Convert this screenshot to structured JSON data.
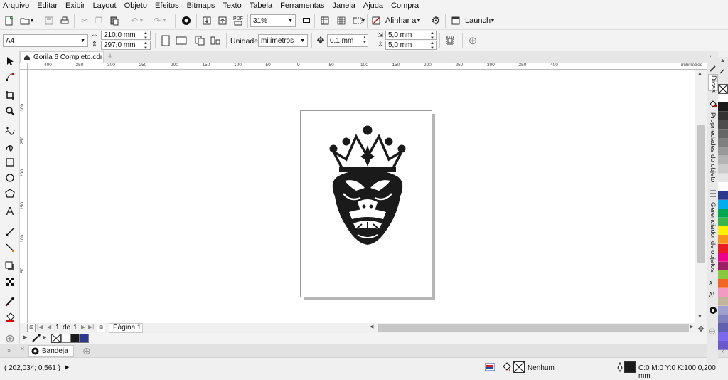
{
  "menu": [
    "Arquivo",
    "Editar",
    "Exibir",
    "Layout",
    "Objeto",
    "Efeitos",
    "Bitmaps",
    "Texto",
    "Tabela",
    "Ferramentas",
    "Janela",
    "Ajuda",
    "Compra"
  ],
  "toolbar": {
    "zoom": "31%",
    "pdf_label": "PDF",
    "align_label": "Alinhar a",
    "launch_label": "Launch"
  },
  "propbar": {
    "page_size": "A4",
    "width": "210,0 mm",
    "height": "297,0 mm",
    "units_label": "Unidades:",
    "units": "milímetros",
    "nudge": "0,1 mm",
    "dup_x": "5,0 mm",
    "dup_y": "5,0 mm"
  },
  "document": {
    "tab_title": "Gorila 6 Completo.cdr"
  },
  "ruler": {
    "h_labels": [
      "400",
      "350",
      "300",
      "250",
      "200",
      "150",
      "100",
      "50",
      "0",
      "50",
      "100",
      "150",
      "200",
      "250",
      "300",
      "350",
      "400"
    ],
    "unit": "milímetros",
    "v_labels": [
      "300",
      "250",
      "200",
      "150",
      "100",
      "50"
    ]
  },
  "pages": {
    "current": "1",
    "of": "de",
    "total": "1",
    "page_tab": "Página 1"
  },
  "tray": {
    "label": "Bandeja"
  },
  "status": {
    "coords": "( 202,034; 0,561 )",
    "fill_label": "Nenhum",
    "outline_info": "C:0 M:0 Y:0 K:100  0,200 mm"
  },
  "docker": {
    "tabs": [
      "Dicas",
      "Propriedades do objeto",
      "Gerenciador de objetos"
    ]
  },
  "palette": {
    "colors": [
      "#ffffff",
      "#1a1a1a",
      "#333333",
      "#4d4d4d",
      "#666666",
      "#808080",
      "#999999",
      "#b3b3b3",
      "#cccccc",
      "#e6e6e6",
      "#ffffff",
      "#2b3990",
      "#00aeef",
      "#00a651",
      "#39b54a",
      "#fff200",
      "#f7941d",
      "#ed1c24",
      "#ec008c",
      "#9e1f63",
      "#8dc63f",
      "#f26522",
      "#f49ac1",
      "#c2b59b",
      "#a0a0d0",
      "#8080c0",
      "#6060b0",
      "#7b68ee",
      "#6a5acd"
    ],
    "doc_colors": [
      "#ffffff",
      "#1a1a1a",
      "#2b3990"
    ]
  }
}
